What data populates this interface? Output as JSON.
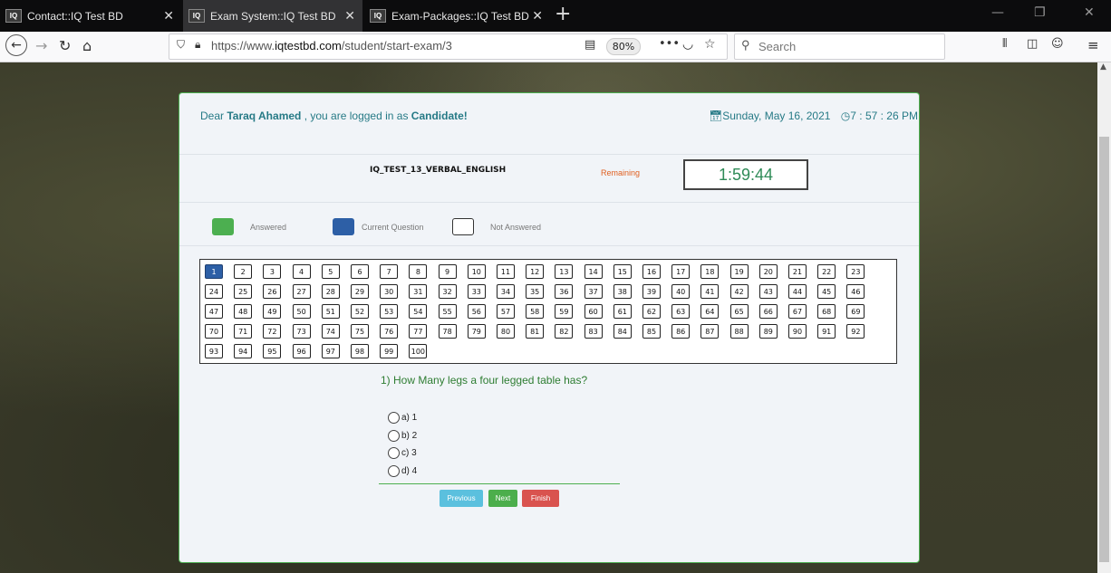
{
  "browser": {
    "tabs": [
      {
        "title": "Contact::IQ Test BD",
        "active": false
      },
      {
        "title": "Exam System::IQ Test BD",
        "active": true
      },
      {
        "title": "Exam-Packages::IQ Test BD",
        "active": false
      }
    ],
    "favicon_text": "IQ",
    "url_prefix": "https://www.",
    "url_domain": "iqtestbd.com",
    "url_path": "/student/start-exam/3",
    "zoom": "80%",
    "search_placeholder": "Search"
  },
  "exam": {
    "greeting_prefix": "Dear ",
    "user_name": "Taraq Ahamed",
    "greeting_mid": " , you are logged in as ",
    "role": "Candidate!",
    "date": "Sunday, May 16, 2021",
    "time": "7 : 57 : 26 PM",
    "exam_name": "IQ_TEST_13_VERBAL_ENGLISH",
    "remaining_label": "Remaining",
    "timer": "1:59:44",
    "legend": {
      "answered": "Answered",
      "current": "Current Question",
      "not_answered": "Not Answered"
    },
    "question_count": 100,
    "current_question": 1,
    "question_text": "1) How Many legs a four legged table has?",
    "options": [
      "a) 1",
      "b) 2",
      "c) 3",
      "d) 4"
    ],
    "buttons": {
      "previous": "Previous",
      "next": "Next",
      "finish": "Finish"
    }
  },
  "colors": {
    "answered": "#4caf50",
    "current": "#2d5fa6",
    "not_answered": "#ffffff",
    "previous_btn": "#5bc0de",
    "next_btn": "#4cae4c",
    "finish_btn": "#d9534f",
    "accent_text": "#267a86"
  }
}
